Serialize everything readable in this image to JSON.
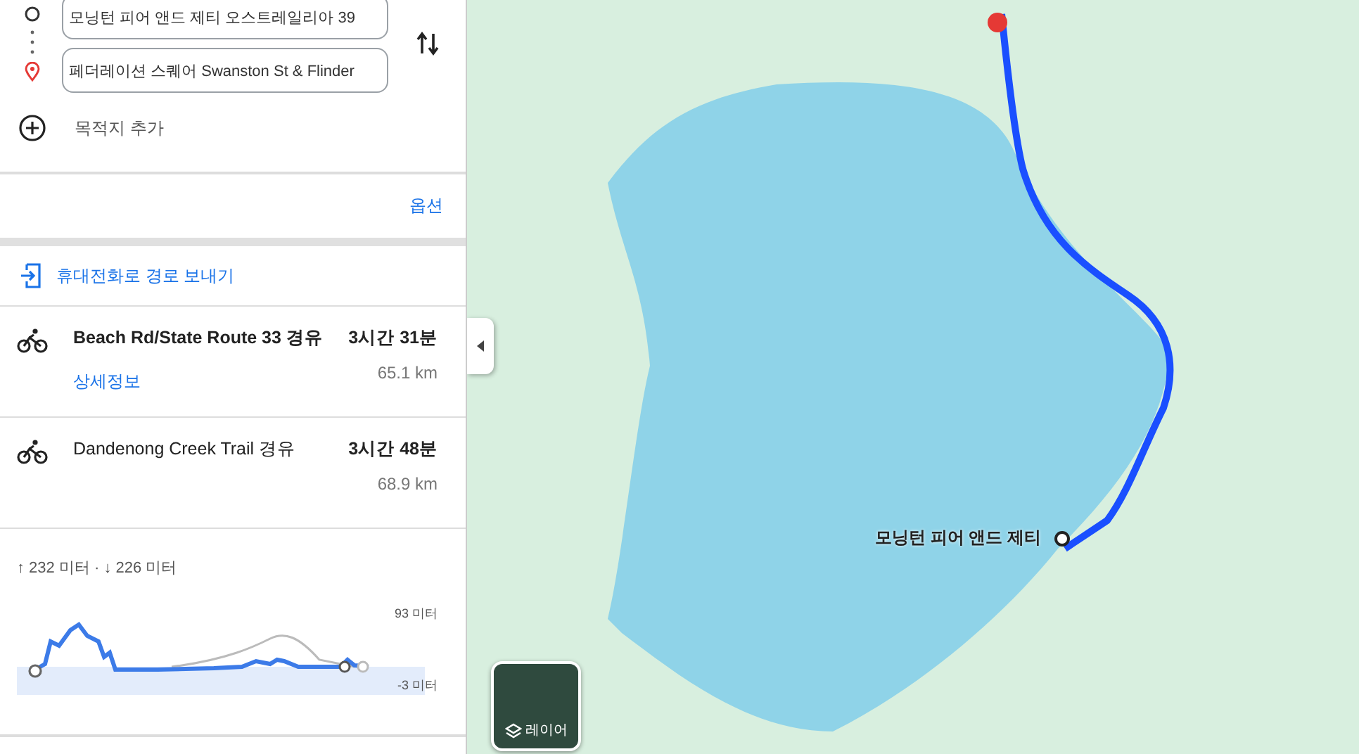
{
  "directions": {
    "origin": {
      "value": "모닝턴 피어 앤드 제티 오스트레일리아 39"
    },
    "destination": {
      "value": "페더레이션 스퀘어 Swanston St & Flinder"
    },
    "add_destination": "목적지 추가"
  },
  "options_link": "옵션",
  "send_to_phone": "휴대전화로 경로 보내기",
  "routes": [
    {
      "name": "Beach Rd/State Route 33 경유",
      "duration": "3시간 31분",
      "distance": "65.1 km",
      "details_link": "상세정보",
      "selected": true
    },
    {
      "name": "Dandenong Creek Trail 경유",
      "duration": "3시간 48분",
      "distance": "68.9 km",
      "selected": false
    }
  ],
  "elevation": {
    "summary": "↑ 232 미터 · ↓ 226 미터",
    "max_label": "93 미터",
    "min_label": "-3 미터"
  },
  "map": {
    "place_label": "모닝턴 피어 앤드 제티",
    "layers_button": "레이어"
  }
}
